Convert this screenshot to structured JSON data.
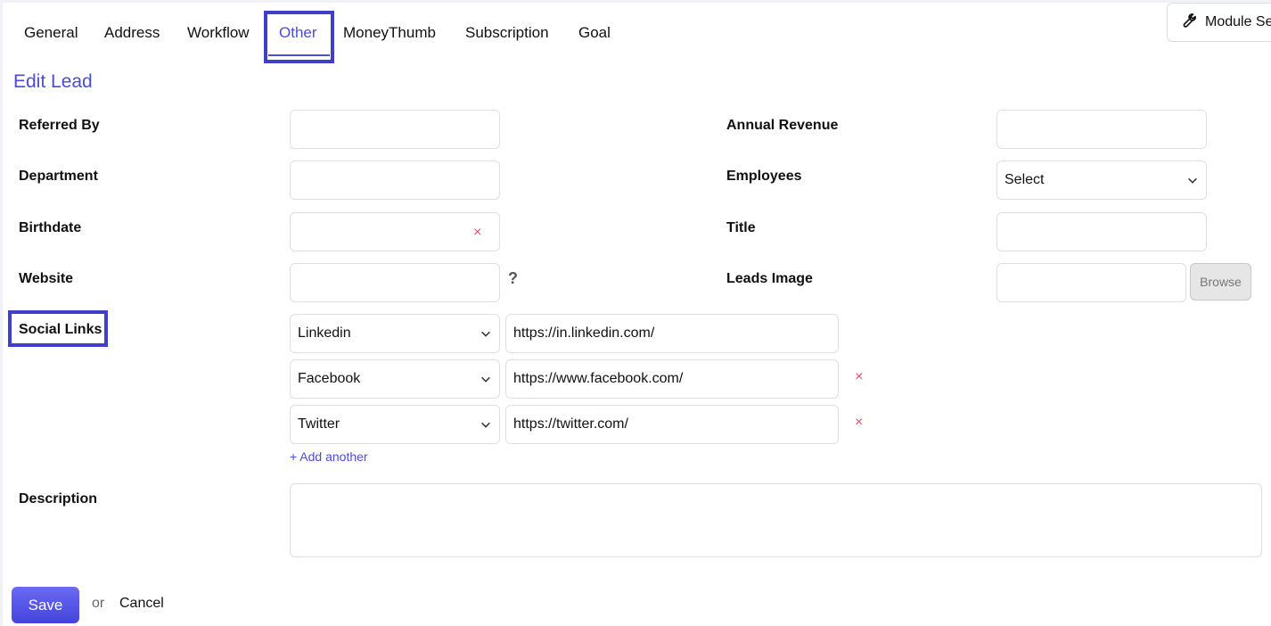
{
  "tabs": [
    {
      "label": "General"
    },
    {
      "label": "Address"
    },
    {
      "label": "Workflow"
    },
    {
      "label": "Other",
      "active": true
    },
    {
      "label": "MoneyThumb"
    },
    {
      "label": "Subscription"
    },
    {
      "label": "Goal"
    }
  ],
  "module_settings": {
    "label": "Module Se",
    "icon": "wrench-icon"
  },
  "form": {
    "heading": "Edit Lead",
    "fields": {
      "referred_by": {
        "label": "Referred By",
        "value": ""
      },
      "department": {
        "label": "Department",
        "value": ""
      },
      "birthdate": {
        "label": "Birthdate",
        "value": "",
        "clear_glyph": "×"
      },
      "website": {
        "label": "Website",
        "value": "",
        "help_glyph": "?"
      },
      "annual_revenue": {
        "label": "Annual Revenue",
        "value": ""
      },
      "employees": {
        "label": "Employees",
        "value": "Select"
      },
      "title": {
        "label": "Title",
        "value": ""
      },
      "leads_image": {
        "label": "Leads Image",
        "value": "",
        "browse_label": "Browse"
      }
    },
    "social_links": {
      "label": "Social Links",
      "items": [
        {
          "network": "Linkedin",
          "url": "https://in.linkedin.com/"
        },
        {
          "network": "Facebook",
          "url": "https://www.facebook.com/",
          "remove_glyph": "×"
        },
        {
          "network": "Twitter",
          "url": "https://twitter.com/",
          "remove_glyph": "×"
        }
      ],
      "add_label": "+ Add another"
    },
    "description": {
      "label": "Description",
      "value": ""
    }
  },
  "actions": {
    "save_label": "Save",
    "or_text": "or",
    "cancel_label": "Cancel"
  },
  "colors": {
    "accent": "#4b4be0",
    "highlight_border": "#3f3fc8",
    "remove_red": "#e0506a"
  }
}
